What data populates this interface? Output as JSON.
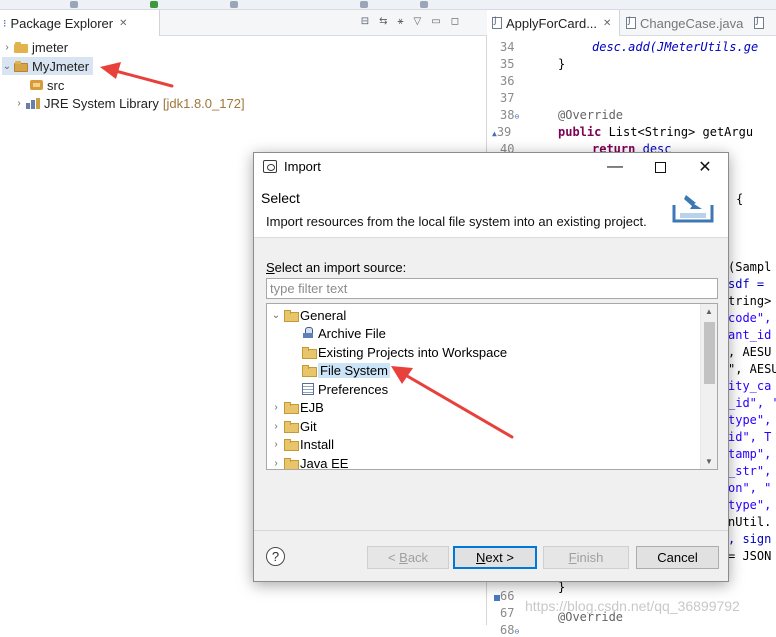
{
  "package_explorer": {
    "tab_label": "Package Explorer",
    "tree": [
      {
        "label": "jmeter",
        "expanded": false
      },
      {
        "label": "MyJmeter",
        "expanded": true,
        "selected": true
      },
      {
        "label": "src"
      },
      {
        "label": "JRE System Library",
        "suffix": "[jdk1.8.0_172]",
        "expanded": false
      }
    ]
  },
  "editor": {
    "tabs": [
      "ApplyForCard...",
      "ChangeCase.java"
    ],
    "line_numbers": [
      "34",
      "35",
      "36",
      "37",
      "38",
      "39",
      "40",
      "66",
      "67",
      "68"
    ],
    "lines": {
      "l34": "desc.add(JMeterUtils.ge",
      "l35": "}",
      "l38": "@Override",
      "l39a": "public",
      "l39b": " List<String> getArgu",
      "l40a": "return",
      "l40b": "desc",
      "brace": "{",
      "r1": "(Sampl",
      "r2": "sdf = ",
      "r3": "tring>",
      "r4": "code\",",
      "r5": "ant_id",
      "r6": ", AESU",
      "r7": "\", AESU",
      "r8": "ity_ca",
      "r9": "_id\", '",
      "r10": "type\",",
      "r11": "id\", T",
      "r12": "tamp\",",
      "r13": "_str\",",
      "r14": "on\", \"",
      "r15": "type\",",
      "r16": "nUtil.",
      "r17": ", sign",
      "r18": "= JSON",
      "l67": "}",
      "l68": "@Override"
    }
  },
  "watermark": "https://blog.csdn.net/qq_36899792",
  "dialog": {
    "title": "Import",
    "heading": "Select",
    "description": "Import resources from the local file system into an existing project.",
    "source_label_pre": "",
    "source_label_ul": "S",
    "source_label_post": "elect an import source:",
    "filter_placeholder": "type filter text",
    "items": {
      "general": "General",
      "archive": "Archive File",
      "existing": "Existing Projects into Workspace",
      "filesystem": "File System",
      "preferences": "Preferences",
      "ejb": "EJB",
      "git": "Git",
      "install": "Install",
      "javaee": "Java EE"
    },
    "buttons": {
      "back_pre": "< ",
      "back_ul": "B",
      "back_post": "ack",
      "next_ul": "N",
      "next_post": "ext >",
      "finish_ul": "F",
      "finish_post": "inish",
      "cancel": "Cancel"
    },
    "help_glyph": "?",
    "minimize_glyph": "—",
    "close_glyph": "✕"
  },
  "colors": {
    "accent": "#0078d7",
    "annotation_arrow": "#e8413c",
    "selection": "#cce4f7"
  }
}
